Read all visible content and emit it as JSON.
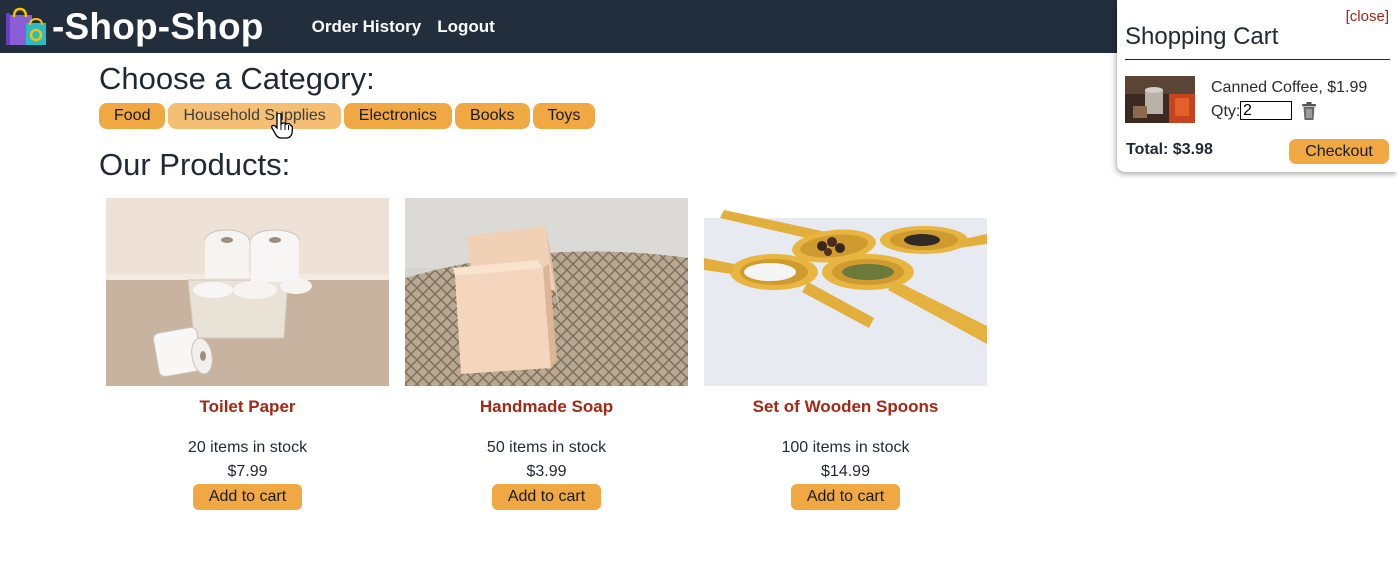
{
  "header": {
    "brand": "-Shop-Shop",
    "logo_icon": "shopping-bag-icon",
    "nav": [
      "Order History",
      "Logout"
    ]
  },
  "categories": {
    "heading": "Choose a Category:",
    "items": [
      "Food",
      "Household Supplies",
      "Electronics",
      "Books",
      "Toys"
    ],
    "hovered": "Household Supplies"
  },
  "products": {
    "heading": "Our Products:",
    "items": [
      {
        "name": "Toilet Paper",
        "stock": "20 items in stock",
        "price": "$7.99",
        "button": "Add to cart",
        "image": "toilet-paper-basket"
      },
      {
        "name": "Handmade Soap",
        "stock": "50 items in stock",
        "price": "$3.99",
        "button": "Add to cart",
        "image": "soap-bars-on-net"
      },
      {
        "name": "Set of Wooden Spoons",
        "stock": "100 items in stock",
        "price": "$14.99",
        "button": "Add to cart",
        "image": "wooden-spoons-with-spices"
      }
    ]
  },
  "cart": {
    "close": "[close]",
    "title": "Shopping Cart",
    "item": {
      "label": "Canned Coffee, $1.99",
      "qty_label": "Qty:",
      "qty": "2",
      "remove_icon": "trash-icon"
    },
    "total": "Total: $3.98",
    "checkout": "Checkout"
  },
  "colors": {
    "header_bg": "#232e3d",
    "accent": "#f0a843",
    "accent_hover": "#f4bf73",
    "product_title": "#a52714"
  }
}
